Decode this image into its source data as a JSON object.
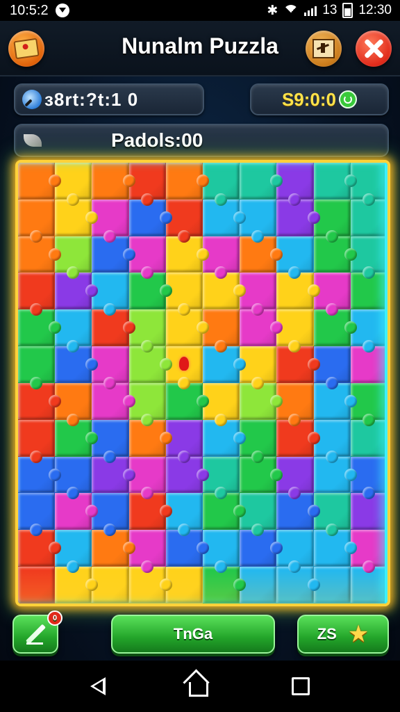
{
  "status_bar": {
    "time": "10:5:2",
    "right_text": "13",
    "clock": "12:30"
  },
  "header": {
    "title": "Nunalm Puzzla"
  },
  "info": {
    "timer_text": "ɜ8rt:?t:1 0",
    "score_text": "S9:0:0",
    "wide_text": "Padols:00"
  },
  "buttons": {
    "main_label": "TnGa",
    "star_label": "ZS",
    "edit_badge": "0"
  },
  "board": {
    "columns": 10,
    "rows": 12,
    "palette": {
      "R": "#f03a1e",
      "O": "#ff7a12",
      "Y": "#ffd21a",
      "L": "#8ee63a",
      "G": "#22c84a",
      "T": "#1ec8a0",
      "C": "#22b8f0",
      "B": "#2a6cf0",
      "P": "#8a3ae6",
      "M": "#e63ac8"
    },
    "rows_colors": [
      "OYOROTTPTT",
      "OYMBRCCPGT",
      "OLBMYMOCGT",
      "RPCGYYMYMG",
      "GCRLYOMYGC",
      "GBMLYCYRBM",
      "ROMLGYLOCG",
      "RGBOPCGRCT",
      "BBPMPTGPCB",
      "BMBRCGTBTP",
      "RCOMBCBCCM",
      "RYYYYGCCCC"
    ]
  }
}
